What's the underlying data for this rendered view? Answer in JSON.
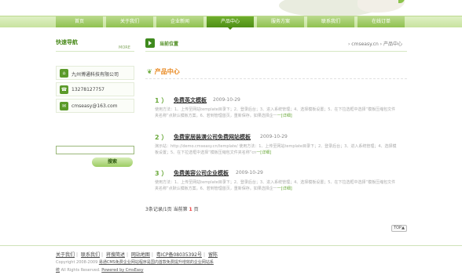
{
  "nav": {
    "items": [
      "首页",
      "关于我们",
      "企业新闻",
      "产品中心",
      "服务方案",
      "联系我们",
      "在线订单"
    ],
    "active_index": 3
  },
  "sidebar": {
    "title": "快速导航",
    "more": "MORE",
    "contacts": [
      {
        "icon": "company-icon",
        "text": "九州博通科技有限公司"
      },
      {
        "icon": "phone-icon",
        "text": "13278127757"
      },
      {
        "icon": "email-icon",
        "text": "cmseasy@163.com"
      }
    ],
    "search_button": "搜索"
  },
  "crumb": {
    "label": "当前位置",
    "path": "› cmseasy.cn  › 产品中心"
  },
  "section": {
    "title": "产品中心"
  },
  "posts": [
    {
      "num": "1 ）",
      "title": "免费英文模板",
      "date": "2009-10-29",
      "desc": "使用方法：1、上传至网站template目录下；2、登录后台；3、进入系统管理；4、选择模板设置；5、在下拉选框中选择“模板压缩包文件夹名称”点默认模板方案。6、若到管理首页，重新保存。如果选择企一",
      "more": "一[详细]"
    },
    {
      "num": "2 ）",
      "title": "免费家居装潢公司免费网站模板",
      "date": "2009-10-29",
      "desc": "演示站：http://demo.cmseasy.cn/template/ 使用方法：1、上传至网站template目录下；2、登录后台；3、进入系统管理；4、选择模板设置；5、在下拉选框中选择“模板压缩包文件夹名称”cn",
      "more": "一[详细]"
    },
    {
      "num": "3 ）",
      "title": "免费美容公司企业模板",
      "date": "2009-10-29",
      "desc": "使用方法：1、上传至网站template目录下；2、登录后台；3、进入系统管理；4、选择模板设置；5、在下拉选框中选择“模板压缩包文件夹名称”点默认模板方案。6、若到管理首页，重新保存。如果选择企一",
      "more": "一[详细]"
    }
  ],
  "pager": {
    "prefix": "3条记录/1页  当前第",
    "current": "1",
    "suffix": "页"
  },
  "top_button": "TOP▲",
  "footer": {
    "links": [
      "关于我们",
      "联系我们",
      "将搜简述",
      "网站地图",
      "粤ICP备08035392号",
      "留陈"
    ],
    "copy1_prefix": "Copyright 2008-2009 ",
    "copy1_link": "易通CMS免费企业网站程序是国内首款免费提升增效的企业网站系",
    "copy2_link": "统",
    "copy2_mid": " All Rights Reserved. ",
    "copy2_power": "Powered by CmsEasy"
  }
}
